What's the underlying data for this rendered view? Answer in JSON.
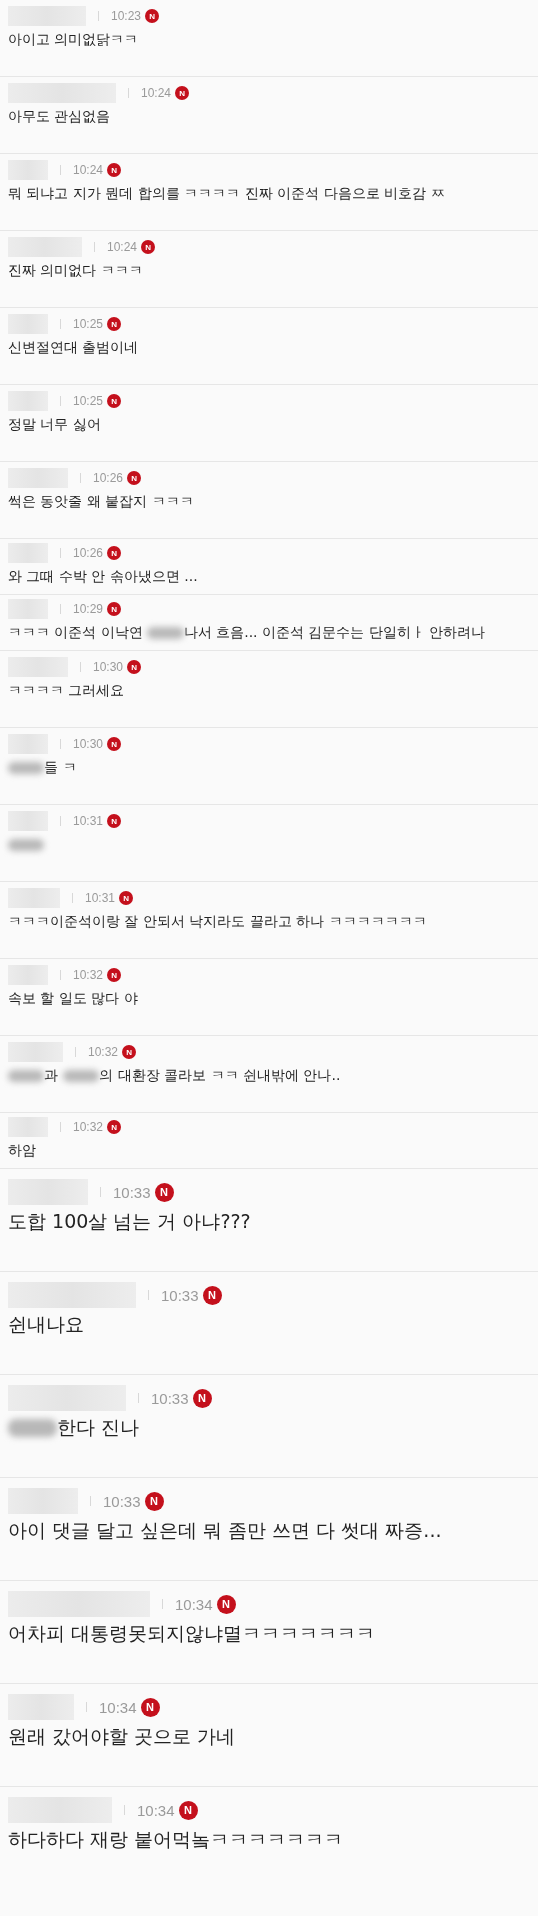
{
  "comments": [
    {
      "kind": "compact",
      "time": "10:23",
      "badge": "N",
      "segments": [
        {
          "kind": "text",
          "text": "아이고 의미없닭ㅋㅋ"
        }
      ]
    },
    {
      "kind": "compact",
      "time": "10:24",
      "badge": "N",
      "segments": [
        {
          "kind": "text",
          "text": "아무도 관심없음"
        }
      ]
    },
    {
      "kind": "compact",
      "time": "10:24",
      "badge": "N",
      "segments": [
        {
          "kind": "text",
          "text": "뭐 되냐고 지가 뭔데 합의를 ㅋㅋㅋㅋ 진짜 이준석 다음으로 비호감 ㅉ"
        }
      ]
    },
    {
      "kind": "compact",
      "time": "10:24",
      "badge": "N",
      "segments": [
        {
          "kind": "text",
          "text": "진짜 의미없다 ㅋㅋㅋ"
        }
      ]
    },
    {
      "kind": "compact",
      "time": "10:25",
      "badge": "N",
      "segments": [
        {
          "kind": "text",
          "text": "신변절연대 출범이네"
        }
      ]
    },
    {
      "kind": "compact",
      "time": "10:25",
      "badge": "N",
      "segments": [
        {
          "kind": "text",
          "text": "정말 너무 싫어"
        }
      ]
    },
    {
      "kind": "compact",
      "time": "10:26",
      "badge": "N",
      "segments": [
        {
          "kind": "text",
          "text": "썩은 동앗줄 왜 붙잡지 ㅋㅋㅋ"
        }
      ]
    },
    {
      "kind": "tight",
      "time": "10:26",
      "badge": "N",
      "segments": [
        {
          "kind": "text",
          "text": "와 그때 수박 안 솎아냈으면 ..."
        }
      ]
    },
    {
      "kind": "tight",
      "time": "10:29",
      "badge": "N",
      "segments": [
        {
          "kind": "text",
          "text": "ㅋㅋㅋ 이준석 이낙연 "
        },
        {
          "kind": "blur"
        },
        {
          "kind": "text",
          "text": "나서 흐음... 이준석 김문수는 단일히ㅏ 안하려나"
        }
      ]
    },
    {
      "kind": "compact",
      "time": "10:30",
      "badge": "N",
      "segments": [
        {
          "kind": "text",
          "text": "ㅋㅋㅋㅋ 그러세요"
        }
      ]
    },
    {
      "kind": "compact",
      "time": "10:30",
      "badge": "N",
      "segments": [
        {
          "kind": "blur"
        },
        {
          "kind": "text",
          "text": "들 ㅋ"
        }
      ]
    },
    {
      "kind": "compact",
      "time": "10:31",
      "badge": "N",
      "segments": [
        {
          "kind": "blur"
        }
      ]
    },
    {
      "kind": "compact",
      "time": "10:31",
      "badge": "N",
      "segments": [
        {
          "kind": "text",
          "text": "ㅋㅋㅋ이준석이랑 잘 안되서 낙지라도 끌라고 하나 ㅋㅋㅋㅋㅋㅋㅋ"
        }
      ]
    },
    {
      "kind": "compact",
      "time": "10:32",
      "badge": "N",
      "segments": [
        {
          "kind": "text",
          "text": "속보 할 일도 많다 야"
        }
      ]
    },
    {
      "kind": "compact",
      "time": "10:32",
      "badge": "N",
      "segments": [
        {
          "kind": "blur"
        },
        {
          "kind": "text",
          "text": "과 "
        },
        {
          "kind": "blur"
        },
        {
          "kind": "text",
          "text": "의 대환장 콜라보 ㅋㅋ 쉰내밖에 안나.."
        }
      ]
    },
    {
      "kind": "tight",
      "time": "10:32",
      "badge": "N",
      "segments": [
        {
          "kind": "text",
          "text": "하암"
        }
      ]
    },
    {
      "kind": "large",
      "time": "10:33",
      "badge": "N",
      "segments": [
        {
          "kind": "text",
          "text": "도합 100살 넘는 거 아냐???"
        }
      ]
    },
    {
      "kind": "large",
      "time": "10:33",
      "badge": "N",
      "segments": [
        {
          "kind": "text",
          "text": "쉰내나요"
        }
      ]
    },
    {
      "kind": "large",
      "time": "10:33",
      "badge": "N",
      "segments": [
        {
          "kind": "blur"
        },
        {
          "kind": "text",
          "text": "한다 진나"
        }
      ]
    },
    {
      "kind": "large",
      "time": "10:33",
      "badge": "N",
      "segments": [
        {
          "kind": "text",
          "text": "아이 댓글 달고 싶은데 뭐 좀만 쓰면 다 썻대 짜증..."
        }
      ]
    },
    {
      "kind": "large",
      "time": "10:34",
      "badge": "N",
      "segments": [
        {
          "kind": "text",
          "text": "어차피 대통령못되지않냐멸ㅋㅋㅋㅋㅋㅋㅋ"
        }
      ]
    },
    {
      "kind": "large",
      "time": "10:34",
      "badge": "N",
      "segments": [
        {
          "kind": "text",
          "text": "원래 갔어야할 곳으로 가네"
        }
      ]
    },
    {
      "kind": "large",
      "time": "10:34",
      "badge": "N",
      "segments": [
        {
          "kind": "text",
          "text": "하다하다 재랑 붙어먹놐ㅋㅋㅋㅋㅋㅋㅋ"
        }
      ]
    }
  ]
}
